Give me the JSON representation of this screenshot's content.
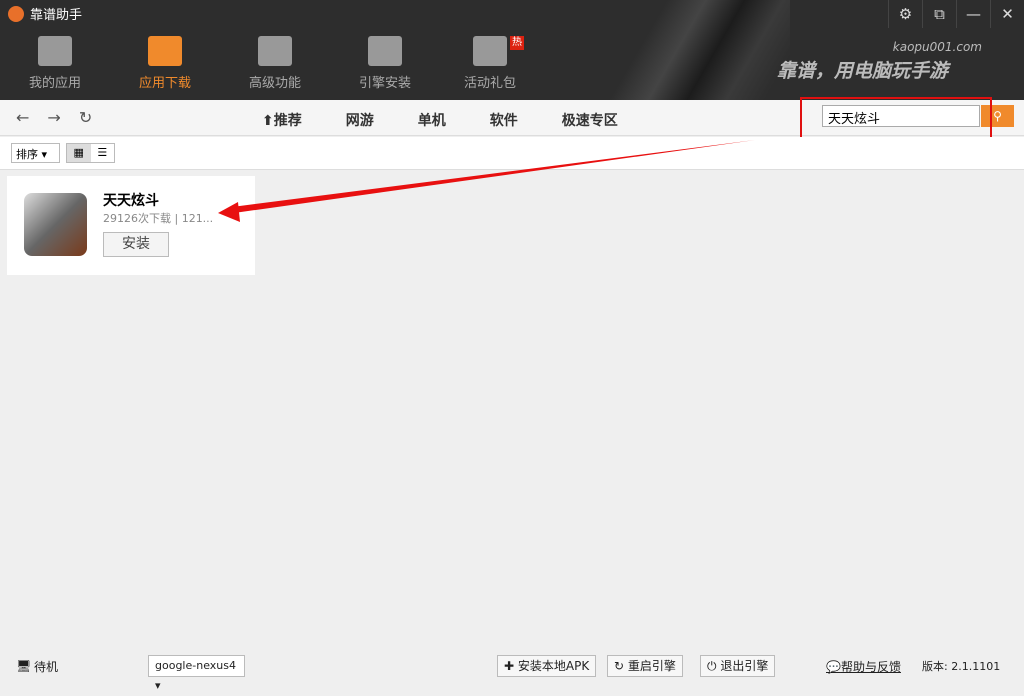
{
  "app": {
    "title": "靠谱助手",
    "site": "kaopu001.com",
    "slogan": "靠谱，用电脑玩手游"
  },
  "nav": [
    {
      "label": "我的应用",
      "icon": "home-icon"
    },
    {
      "label": "应用下载",
      "icon": "download-box-icon",
      "active": true
    },
    {
      "label": "高级功能",
      "icon": "gears-icon"
    },
    {
      "label": "引擎安装",
      "icon": "drive-icon"
    },
    {
      "label": "活动礼包",
      "icon": "gift-icon",
      "badge": "热"
    }
  ],
  "categories": [
    "推荐",
    "网游",
    "单机",
    "软件",
    "极速专区"
  ],
  "search": {
    "value": "天天炫斗"
  },
  "toolbar": {
    "sort": "排序"
  },
  "results": [
    {
      "name": "天天炫斗",
      "meta": "29126次下载 | 121...",
      "install": "安装"
    }
  ],
  "status": {
    "state": "待机",
    "device": "google-nexus4",
    "install_apk": "安装本地APK",
    "restart": "重启引擎",
    "exit": "退出引擎",
    "help": "帮助与反馈",
    "version": "版本: 2.1.1101"
  },
  "accent": "#f08a2c"
}
